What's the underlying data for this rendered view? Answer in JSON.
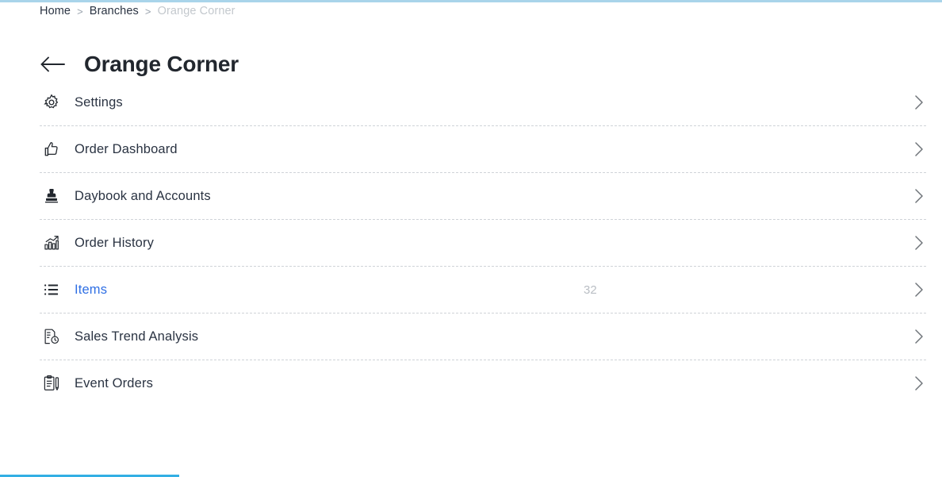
{
  "theme": {
    "accent_top": "#a9d4ea",
    "accent_progress": "#33afe4",
    "active_link": "#2f6fe4",
    "text": "#2a3342",
    "muted": "#b9bec4"
  },
  "breadcrumb": {
    "items": [
      {
        "label": "Home",
        "current": false
      },
      {
        "label": "Branches",
        "current": false
      },
      {
        "label": "Orange Corner",
        "current": true
      }
    ],
    "separator": ">"
  },
  "header": {
    "title": "Orange Corner",
    "back_icon": "arrow-left-icon"
  },
  "menu": {
    "rows": [
      {
        "label": "Settings",
        "icon": "gear-icon",
        "count": "",
        "active": false
      },
      {
        "label": "Order Dashboard",
        "icon": "thumbs-up-icon",
        "count": "",
        "active": false
      },
      {
        "label": "Daybook and Accounts",
        "icon": "stamp-icon",
        "count": "",
        "active": false
      },
      {
        "label": "Order History",
        "icon": "bar-chart-up-icon",
        "count": "",
        "active": false
      },
      {
        "label": "Items",
        "icon": "list-icon",
        "count": "32",
        "active": true
      },
      {
        "label": "Sales Trend Analysis",
        "icon": "document-clock-icon",
        "count": "",
        "active": false
      },
      {
        "label": "Event Orders",
        "icon": "clipboard-pen-icon",
        "count": "",
        "active": false
      }
    ],
    "chevron_icon": "chevron-right-icon"
  },
  "progress": {
    "percent": 19
  }
}
